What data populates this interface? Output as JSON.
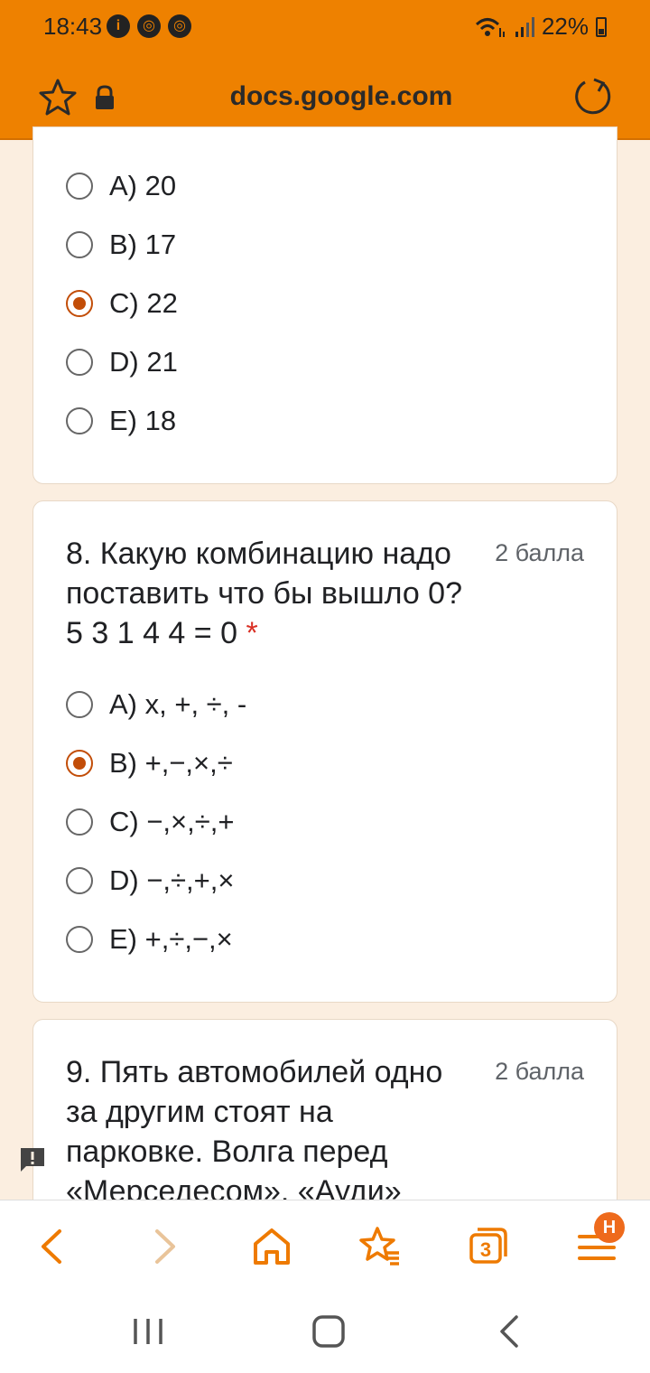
{
  "status_bar": {
    "time": "18:43",
    "battery": "22%"
  },
  "browser": {
    "url": "docs.google.com",
    "tab_count": "3",
    "menu_badge": "H"
  },
  "questions": [
    {
      "options": [
        {
          "label": "A) 20",
          "checked": false
        },
        {
          "label": "B) 17",
          "checked": false
        },
        {
          "label": "C) 22",
          "checked": true
        },
        {
          "label": "D) 21",
          "checked": false
        },
        {
          "label": "E) 18",
          "checked": false
        }
      ]
    },
    {
      "title": "8. Какую комбинацию надо поставить что бы вышло 0? 5 3 1 4 4 = 0",
      "required_mark": "*",
      "points": "2 балла",
      "options": [
        {
          "label": "A) x, +, ÷, -",
          "checked": false
        },
        {
          "label": "B) +,−,×,÷",
          "checked": true
        },
        {
          "label": "C) −,×,÷,+",
          "checked": false
        },
        {
          "label": "D) −,÷,+,×",
          "checked": false
        },
        {
          "label": "E) +,÷,−,×",
          "checked": false
        }
      ]
    },
    {
      "title": "9. Пять автомобилей одно за другим стоят на парковке. Волга перед «Мерседесом». «Ауди»",
      "points": "2 балла"
    }
  ]
}
